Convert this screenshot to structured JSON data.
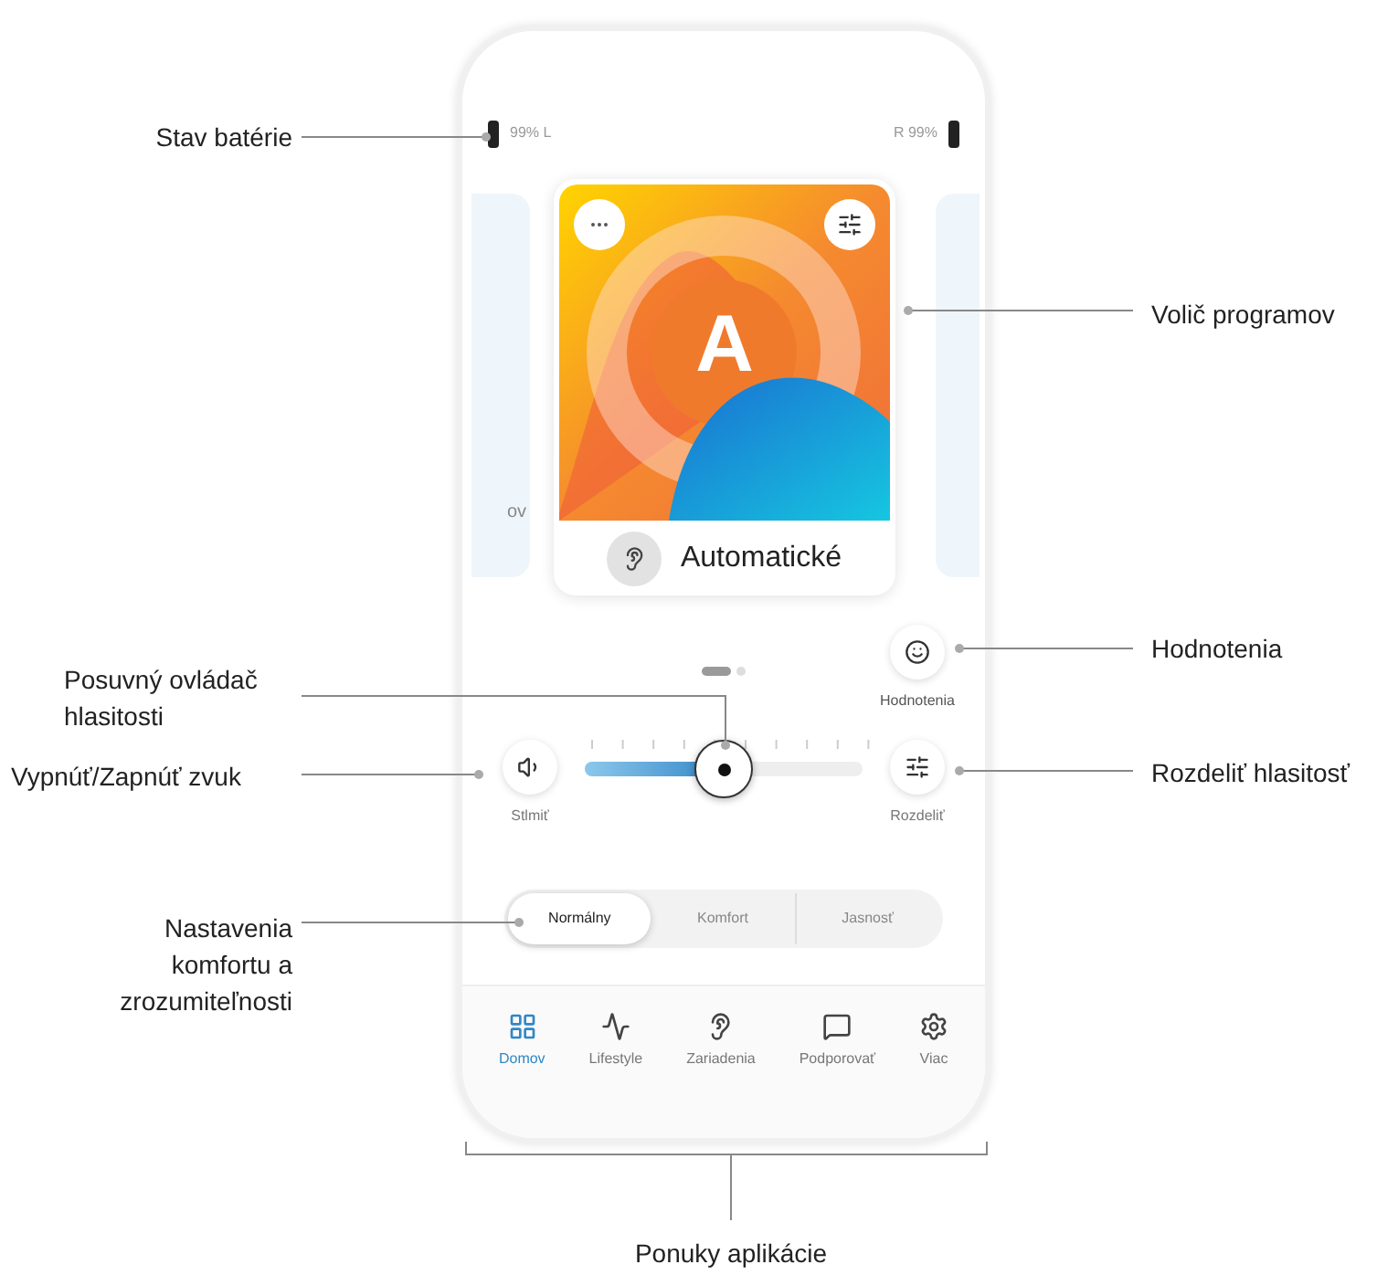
{
  "annotations": [
    {
      "label": "Stav batérie"
    },
    {
      "label": "Volič programov"
    },
    {
      "label": "Posuvný ovládač hlasitosti"
    },
    {
      "label": "Hodnotenia"
    },
    {
      "label": "Vypnúť/Zapnúť zvuk"
    },
    {
      "label": "Rozdeliť hlasitosť"
    },
    {
      "label": "Nastavenia komfortu a zrozumiteľnosti"
    },
    {
      "label": "Ponuky aplikácie"
    }
  ],
  "phone": {
    "battery": {
      "left": "99% L",
      "right": "R 99%"
    },
    "carousel": {
      "left_peek_text": "ov",
      "program": {
        "letter": "A",
        "name": "Automatické"
      },
      "pages": [
        {
          "selected": true
        },
        {
          "selected": false
        }
      ]
    },
    "rating": {
      "label": "Hodnotenia"
    },
    "volume": {
      "mute_label": "Stlmiť",
      "split_label": "Rozdeliť",
      "level": 0.5
    },
    "modes": [
      {
        "label": "Normálny",
        "selected": true
      },
      {
        "label": "Komfort",
        "selected": false
      },
      {
        "label": "Jasnosť",
        "selected": false
      }
    ],
    "nav": [
      {
        "label": "Domov",
        "selected": true
      },
      {
        "label": "Lifestyle",
        "selected": false
      },
      {
        "label": "Zariadenia",
        "selected": false
      },
      {
        "label": "Podporovať",
        "selected": false
      },
      {
        "label": "Viac",
        "selected": false
      }
    ]
  }
}
